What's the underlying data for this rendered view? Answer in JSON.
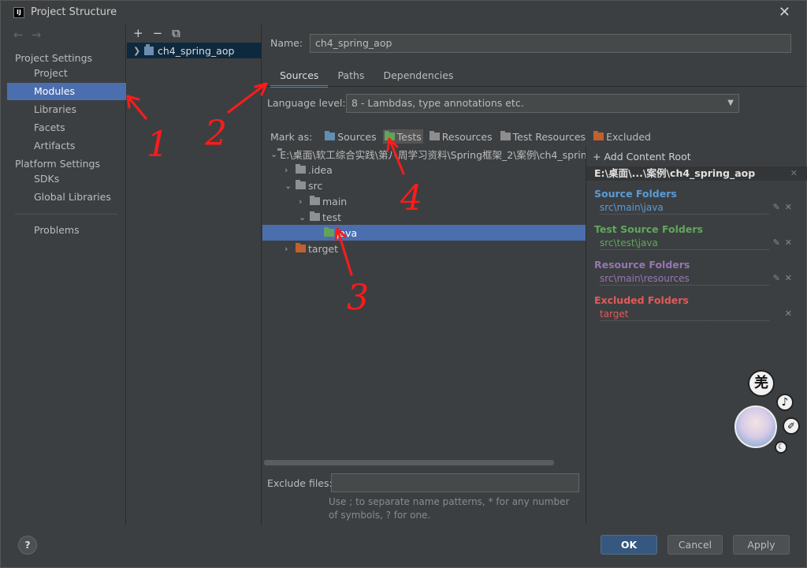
{
  "window": {
    "title": "Project Structure",
    "close": "✕"
  },
  "nav": {
    "back": "←",
    "forward": "→",
    "project_settings": "Project Settings",
    "items_ps": [
      "Project",
      "Modules",
      "Libraries",
      "Facets",
      "Artifacts"
    ],
    "platform_settings": "Platform Settings",
    "items_plat": [
      "SDKs",
      "Global Libraries"
    ],
    "problems": "Problems",
    "selected": "Modules"
  },
  "modules": {
    "add": "+",
    "remove": "−",
    "copy": "⧉",
    "list": [
      "ch4_spring_aop"
    ]
  },
  "detail": {
    "name_label": "Name:",
    "name_value": "ch4_spring_aop",
    "tabs": [
      "Sources",
      "Paths",
      "Dependencies"
    ],
    "active_tab": "Sources",
    "language_label": "Language level:",
    "language_value": "8 - Lambdas, type annotations etc.",
    "mark_as_label": "Mark as:",
    "mark_buttons": [
      "Sources",
      "Tests",
      "Resources",
      "Test Resources",
      "Excluded"
    ],
    "tree": [
      {
        "label": "E:\\桌面\\软工综合实践\\第八周学习资料\\Spring框架_2\\案例\\ch4_sprin",
        "depth": 0,
        "expanded": true,
        "kind": "gray"
      },
      {
        "label": ".idea",
        "depth": 1,
        "expanded": false,
        "kind": "gray"
      },
      {
        "label": "src",
        "depth": 1,
        "expanded": true,
        "kind": "gray"
      },
      {
        "label": "main",
        "depth": 2,
        "expanded": false,
        "kind": "gray"
      },
      {
        "label": "test",
        "depth": 2,
        "expanded": true,
        "kind": "gray"
      },
      {
        "label": "java",
        "depth": 3,
        "expanded": null,
        "kind": "green",
        "selected": true
      },
      {
        "label": "target",
        "depth": 1,
        "expanded": false,
        "kind": "orange"
      }
    ],
    "exclude_label": "Exclude files:",
    "exclude_value": "",
    "hint": "Use ; to separate name patterns, * for any number of symbols, ? for one."
  },
  "roots": {
    "add_content_root": "+ Add Content Root",
    "root_path": "E:\\桌面\\...\\案例\\ch4_spring_aop",
    "groups": [
      {
        "title": "Source Folders",
        "path": "src\\main\\java",
        "color": "#5a9bd8"
      },
      {
        "title": "Test Source Folders",
        "path": "src\\test\\java",
        "color": "#5fa95a"
      },
      {
        "title": "Resource Folders",
        "path": "src\\main\\resources",
        "color": "#9776b3"
      },
      {
        "title": "Excluded Folders",
        "path": "target",
        "color": "#e25a5a"
      }
    ]
  },
  "buttons": {
    "help": "?",
    "ok": "OK",
    "cancel": "Cancel",
    "apply": "Apply"
  },
  "annotations": [
    "1",
    "2",
    "3",
    "4"
  ],
  "overlay": {
    "badge_top": "羌"
  }
}
